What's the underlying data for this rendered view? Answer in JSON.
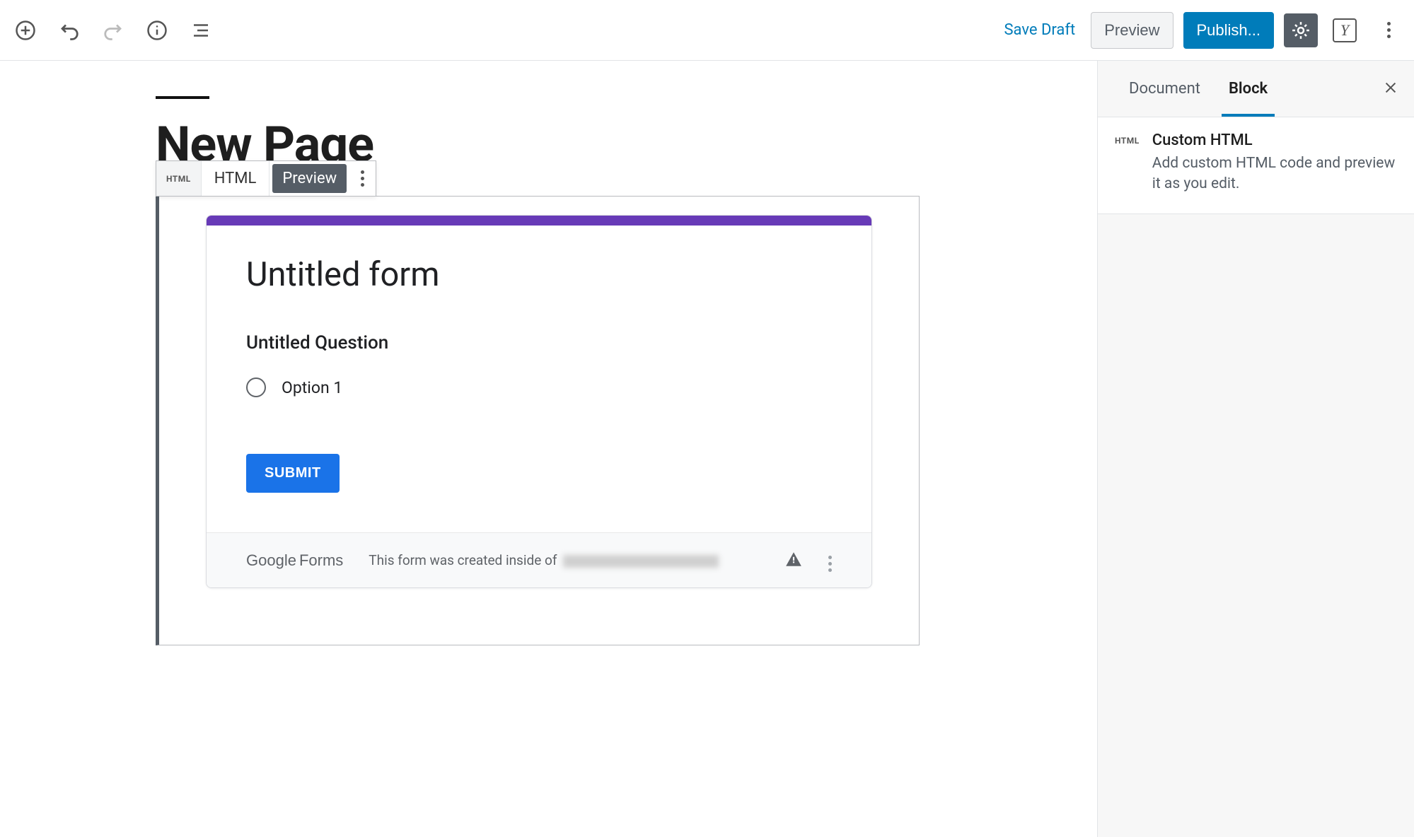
{
  "toolbar": {
    "save_draft": "Save Draft",
    "preview": "Preview",
    "publish": "Publish..."
  },
  "page_title": "New Page",
  "block_toolbar": {
    "icon_label": "HTML",
    "html_tab": "HTML",
    "preview_tab": "Preview"
  },
  "form": {
    "title": "Untitled form",
    "question": "Untitled Question",
    "option1": "Option 1",
    "submit": "SUBMIT",
    "google": "Google",
    "forms": "Forms",
    "created_prefix": "This form was created inside of "
  },
  "sidebar": {
    "tab_document": "Document",
    "tab_block": "Block",
    "panel_icon": "HTML",
    "panel_title": "Custom HTML",
    "panel_desc": "Add custom HTML code and preview it as you edit."
  }
}
